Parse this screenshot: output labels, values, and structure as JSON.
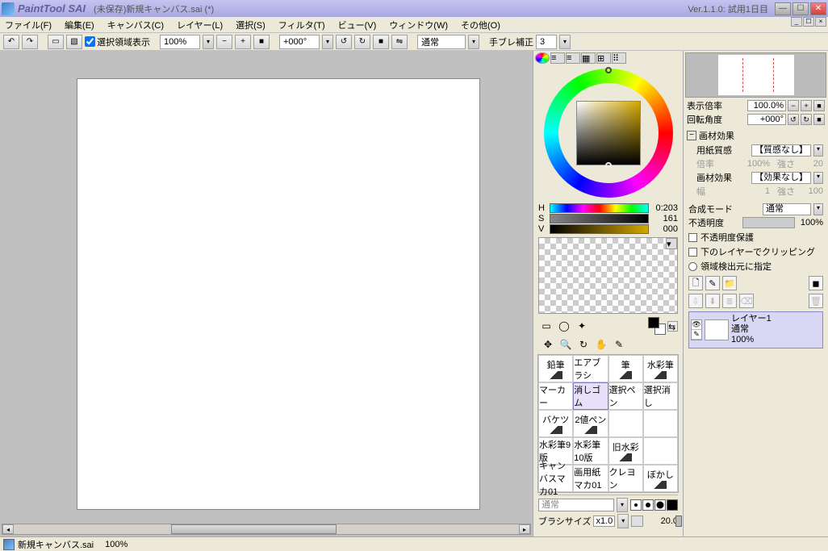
{
  "titlebar": {
    "appname": "PaintTool SAI",
    "doc": "(未保存)新規キャンバス.sai (*)",
    "version": "Ver.1.1.0: 試用1日目"
  },
  "menu": {
    "file": "ファイル(F)",
    "edit": "編集(E)",
    "canvas": "キャンバス(C)",
    "layer": "レイヤー(L)",
    "select": "選択(S)",
    "filter": "フィルタ(T)",
    "view": "ビュー(V)",
    "window": "ウィンドウ(W)",
    "other": "その他(O)"
  },
  "toolbar": {
    "sel_disp": "選択領域表示",
    "zoom": "100%",
    "angle": "+000°",
    "mode": "通常",
    "stab_label": "手ブレ補正",
    "stab_val": "3"
  },
  "hsv": {
    "h_label": "H",
    "h_val": "0:203",
    "s_label": "S",
    "s_val": "161",
    "v_label": "V",
    "v_val": "000"
  },
  "brushes": [
    [
      "鉛筆",
      "エアブラシ",
      "筆",
      "水彩筆"
    ],
    [
      "マーカー",
      "消しゴム",
      "選択ペン",
      "選択消し"
    ],
    [
      "バケツ",
      "2値ペン",
      "",
      ""
    ],
    [
      "水彩筆9版",
      "水彩筆10版",
      "旧水彩",
      ""
    ],
    [
      "キャンバスマカ01",
      "画用紙マカ01",
      "クレヨン",
      "ぼかし"
    ]
  ],
  "brush_sel": [
    1,
    1
  ],
  "brush_mode": "通常",
  "brush_size_label": "ブラシサイズ",
  "brush_size_mult": "x1.0",
  "brush_size_val": "20.0",
  "nav": {
    "zoom_label": "表示倍率",
    "zoom_val": "100.0%",
    "rot_label": "回転角度",
    "rot_val": "+000°"
  },
  "effects": {
    "head": "画材効果",
    "paper_label": "用紙質感",
    "paper_val": "【質感なし】",
    "scale_label": "倍率",
    "scale_val": "100%",
    "str_label": "強さ",
    "str_val": "20",
    "eff_label": "画材効果",
    "eff_val": "【効果なし】",
    "width_label": "幅",
    "width_val": "1",
    "str2_label": "強さ",
    "str2_val": "100"
  },
  "compose": {
    "mode_label": "合成モード",
    "mode_val": "通常",
    "opac_label": "不透明度",
    "opac_val": "100%"
  },
  "checks": {
    "preserve": "不透明度保護",
    "clip": "下のレイヤーでクリッピング",
    "selsrc": "領域検出元に指定"
  },
  "layer": {
    "name": "レイヤー1",
    "mode": "通常",
    "opac": "100%"
  },
  "status": {
    "doc": "新規キャンバス.sai",
    "zoom": "100%"
  }
}
